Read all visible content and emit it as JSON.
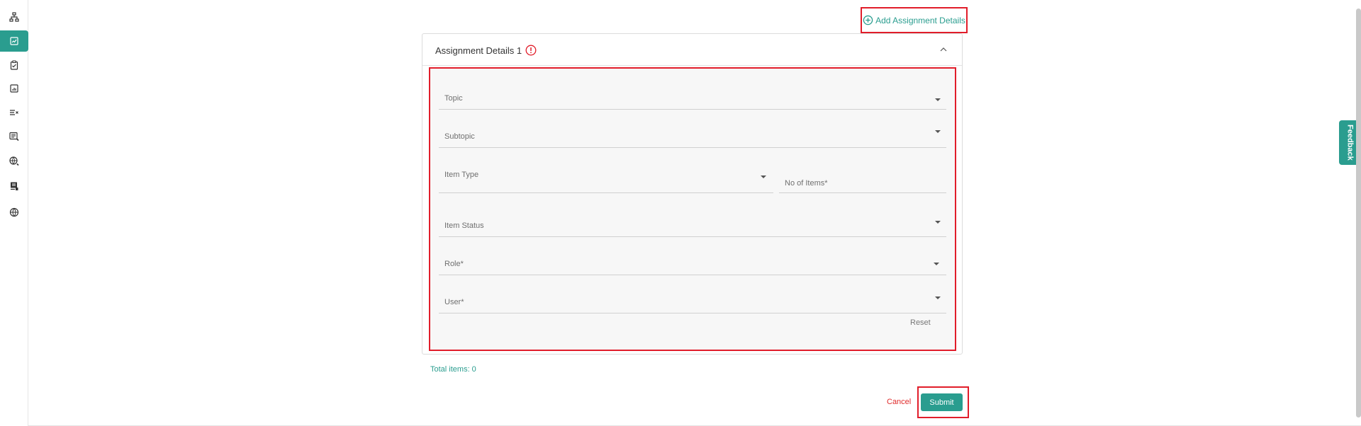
{
  "sidebar": {
    "items": [
      {
        "icon": "sitemap-icon",
        "active": false
      },
      {
        "icon": "assignment-icon",
        "active": true
      },
      {
        "icon": "clipboard-icon",
        "active": false
      },
      {
        "icon": "report-icon",
        "active": false
      },
      {
        "icon": "list-x-icon",
        "active": false
      },
      {
        "icon": "document-edit-icon",
        "active": false
      },
      {
        "icon": "globe-edit-icon",
        "active": false
      },
      {
        "icon": "id-card-icon",
        "active": false
      },
      {
        "icon": "globe-icon",
        "active": false
      }
    ]
  },
  "toolbar": {
    "add_assignment_label": "Add Assignment Details"
  },
  "panel": {
    "title": "Assignment Details 1",
    "fields": {
      "topic": "Topic",
      "subtopic": "Subtopic",
      "item_type": "Item Type",
      "no_of_items": "No of Items*",
      "item_status": "Item Status",
      "role": "Role*",
      "user": "User*"
    },
    "reset_label": "Reset"
  },
  "summary": {
    "total_items": "Total items: 0"
  },
  "actions": {
    "cancel_label": "Cancel",
    "submit_label": "Submit"
  },
  "feedback_label": "Feedback",
  "colors": {
    "accent": "#2a9d8f",
    "highlight": "#e11d2a",
    "cancel": "#e02b2b"
  }
}
